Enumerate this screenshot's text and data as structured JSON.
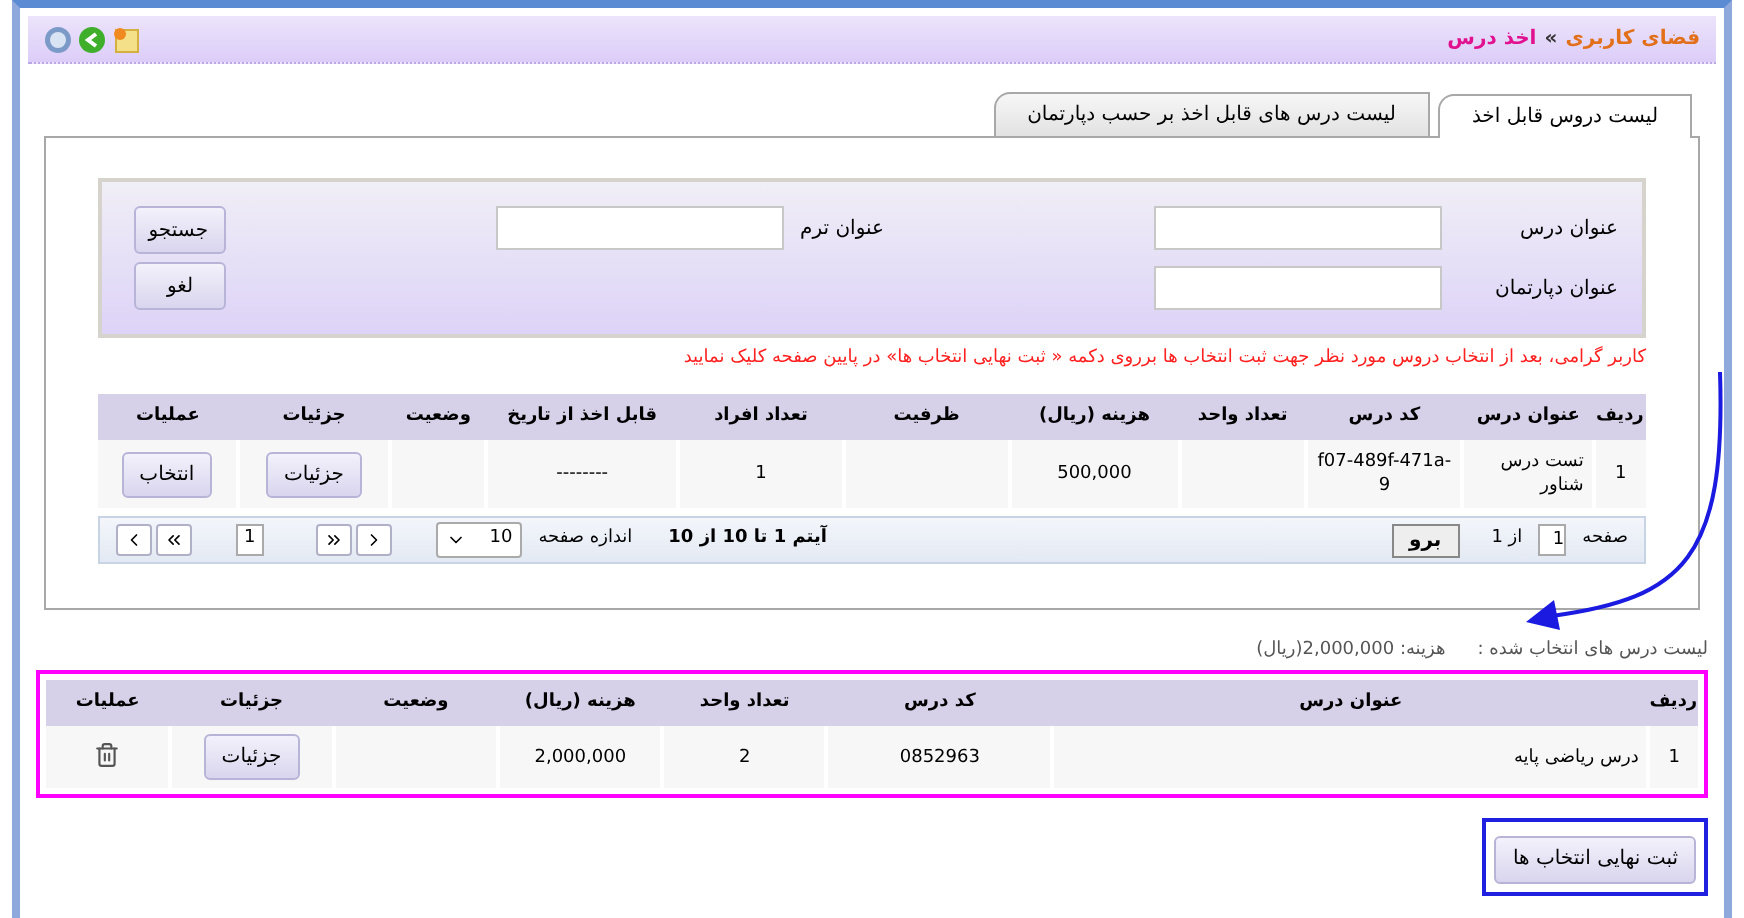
{
  "breadcrumb": {
    "items": [
      "فضای کاربری",
      "اخذ درس"
    ],
    "separator": "»"
  },
  "tabs": [
    {
      "label": "لیست دروس قابل اخذ",
      "selected": true
    },
    {
      "label": "لیست درس های قابل اخذ بر حسب دپارتمان",
      "selected": false
    }
  ],
  "search": {
    "fields": [
      {
        "label": "عنوان درس"
      },
      {
        "label": "عنوان دپارتمان"
      },
      {
        "label": "عنوان ترم"
      }
    ],
    "buttons": [
      "جستجو",
      "لغو"
    ]
  },
  "notice": "کاربر گرامی، بعد از انتخاب دروس مورد نظر جهت ثبت انتخاب ها برروی دکمه « ثبت نهایی انتخاب ها» در پایین صفحه کلیک نمایید",
  "available_table": {
    "columns": [
      "ردیف",
      "عنوان درس",
      "کد درس",
      "تعداد واحد",
      "هزینه (ریال)",
      "ظرفیت",
      "تعداد افراد",
      "قابل اخذ از تاریخ",
      "وضعیت",
      "جزئیات",
      "عملیات"
    ],
    "rows": [
      {
        "cells": [
          "1",
          "تست درس شناور",
          "f07-489f-471a-9",
          null,
          "500,000",
          null,
          "1",
          "--------",
          null
        ],
        "details": "جزئیات",
        "action": {
          "kind": "button",
          "label": "انتخاب"
        }
      }
    ]
  },
  "pager": {
    "page_label": "صفحه",
    "page_value": "1",
    "of_label": "از 1",
    "go": "برو",
    "items": "آیتم 1 تا 10 از 10",
    "size_label": "اندازه صفحه",
    "size_value": "10",
    "current_page": "1"
  },
  "selected_list": {
    "label": "لیست درس های انتخاب شده :",
    "total": "هزینه: 2,000,000(ریال)"
  },
  "selected_table": {
    "columns": [
      "ردیف",
      "عنوان درس",
      "کد درس",
      "تعداد واحد",
      "هزینه (ریال)",
      "وضعیت",
      "جزئیات",
      "عملیات"
    ],
    "rows": [
      {
        "cells": [
          "1",
          "درس ریاضی پایه",
          "0852963",
          "2",
          "2,000,000",
          null
        ],
        "details": "جزئیات",
        "action": {
          "kind": "delete"
        }
      }
    ]
  },
  "submit": "ثبت نهایی انتخاب ها"
}
